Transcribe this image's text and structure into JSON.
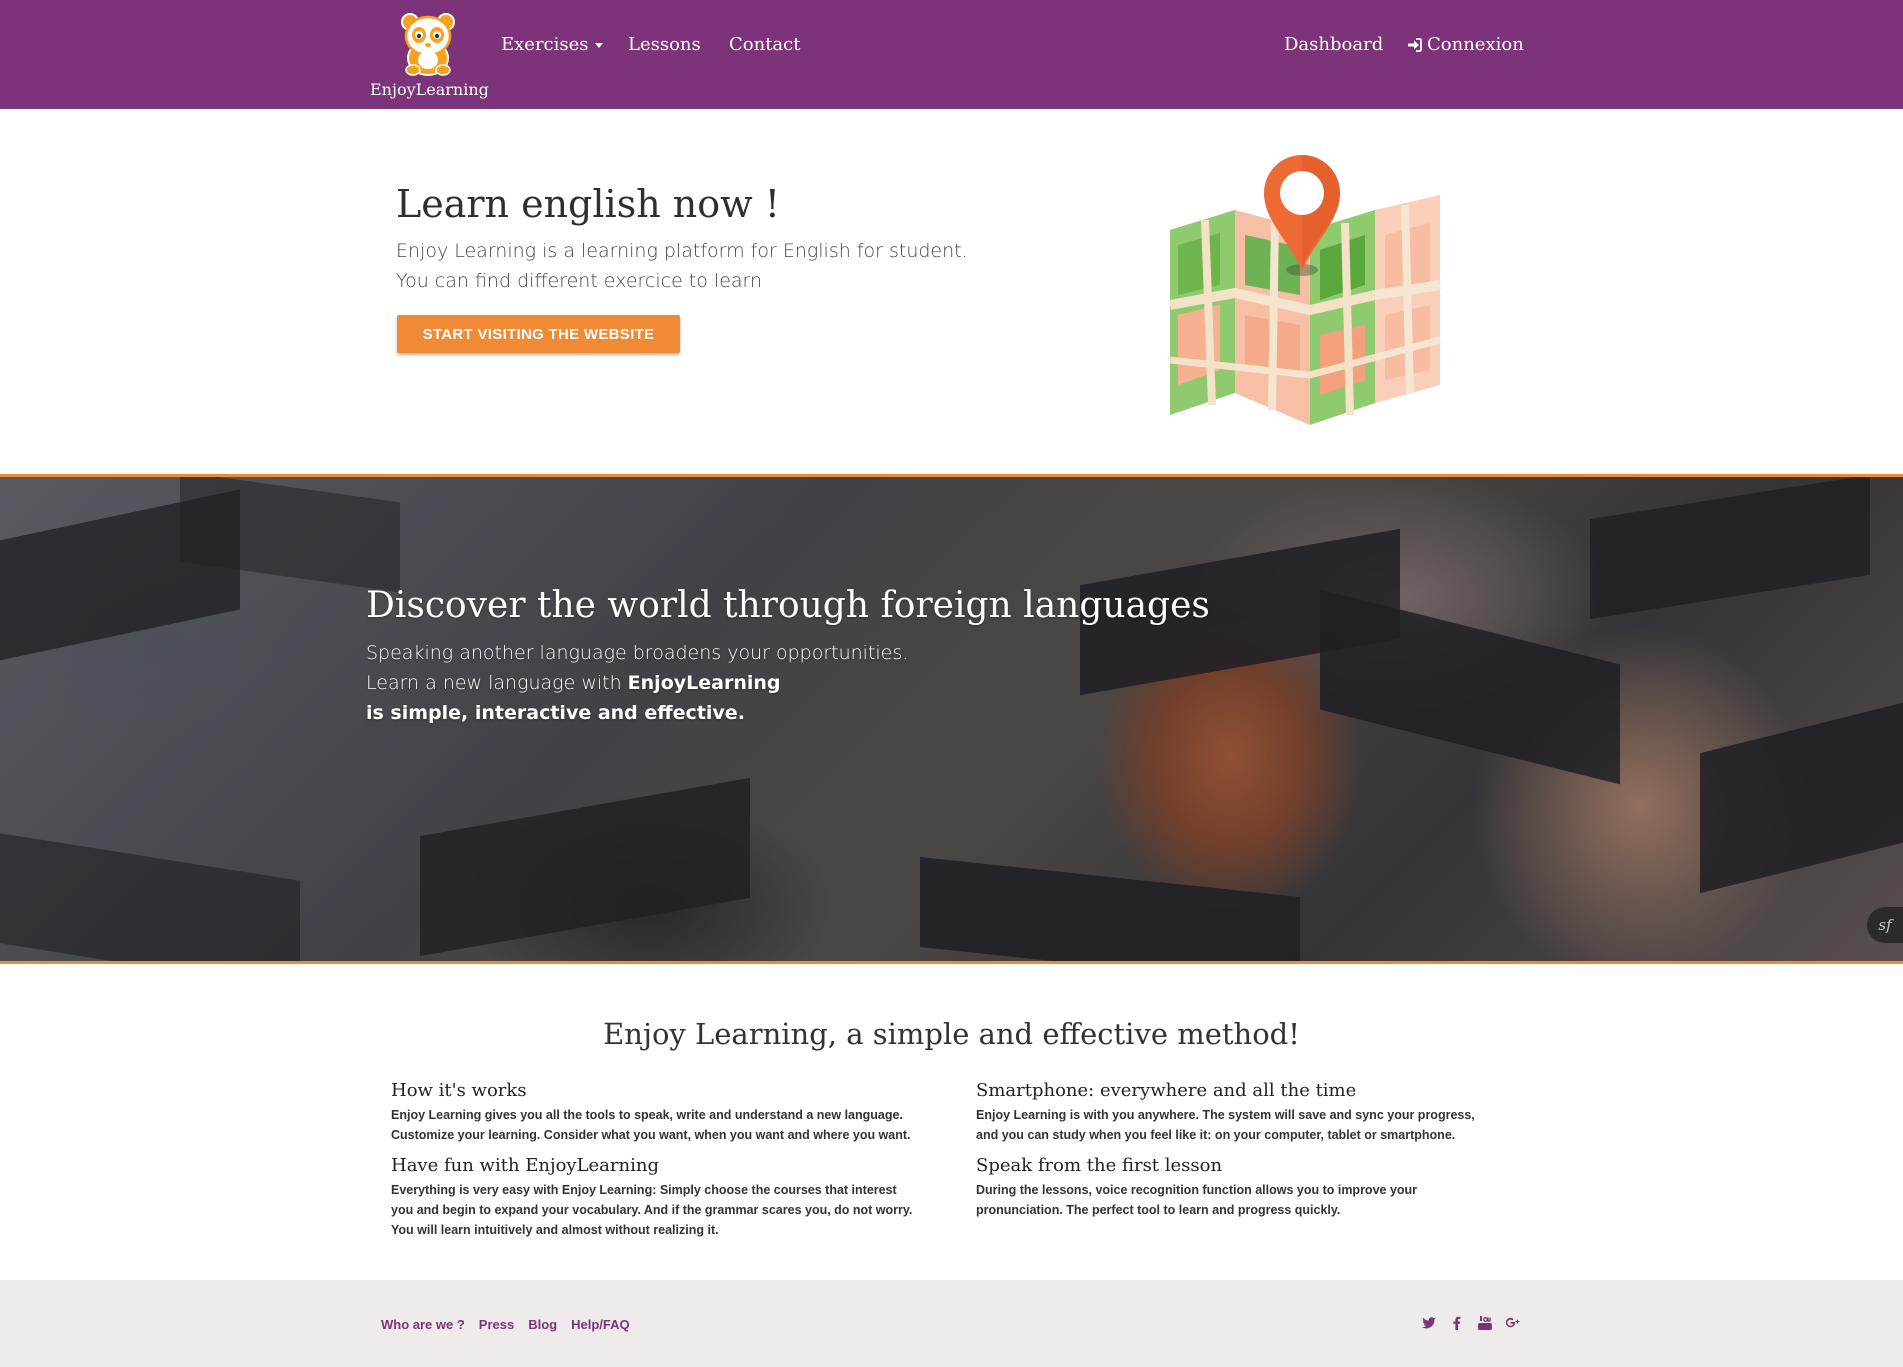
{
  "navbar": {
    "brand_name": "EnjoyLearning",
    "links": {
      "exercises": "Exercises",
      "lessons": "Lessons",
      "contact": "Contact",
      "dashboard": "Dashboard",
      "connexion": "Connexion"
    },
    "background_color": "#7c3379"
  },
  "hero": {
    "title": "Learn english now !",
    "line1": "Enjoy Learning is a learning platform for English for student.",
    "line2": "You can find different exercice to learn",
    "button_label": "START VISITING THE WEBSITE",
    "button_color": "#f08a35",
    "illustration": "map-with-location-pin"
  },
  "banner": {
    "title": "Discover the world through foreign languages",
    "line1": "Speaking another language broadens your opportunities.",
    "line2_prefix": "Learn a new language with ",
    "line2_brand": "EnjoyLearning",
    "line3": "is simple, interactive and effective.",
    "badge": "sf",
    "accent_color": "#f08a35"
  },
  "features": {
    "title": "Enjoy Learning, a simple and effective method!",
    "items": [
      {
        "heading": "How it's works",
        "text_line1": "Enjoy Learning gives you all the tools to speak, write and understand a new language.",
        "text_line2": "Customize your learning. Consider what you want, when you want and where you want.",
        "text_line3": ""
      },
      {
        "heading": "Smartphone: everywhere and all the time",
        "text_line1": "Enjoy Learning is with you anywhere. The system will save and sync your progress,",
        "text_line2": "and you can study when you feel like it: on your computer, tablet or smartphone.",
        "text_line3": ""
      },
      {
        "heading": "Have fun with EnjoyLearning",
        "text_line1": "Everything is very easy with Enjoy Learning: Simply choose the courses that interest",
        "text_line2": "you and begin to expand your vocabulary. And if the grammar scares you, do not worry.",
        "text_line3": "You will learn intuitively and almost without realizing it."
      },
      {
        "heading": "Speak from the first lesson",
        "text_line1": "During the lessons, voice recognition function allows you to improve your",
        "text_line2": "pronunciation. The perfect tool to learn and progress quickly.",
        "text_line3": ""
      }
    ]
  },
  "footer": {
    "links": [
      "Who are we ?",
      "Press",
      "Blog",
      "Help/FAQ"
    ],
    "social_icons": [
      "twitter-icon",
      "facebook-icon",
      "youtube-icon",
      "google-plus-icon"
    ],
    "link_color": "#7c3379",
    "background_color": "#efebeb"
  }
}
